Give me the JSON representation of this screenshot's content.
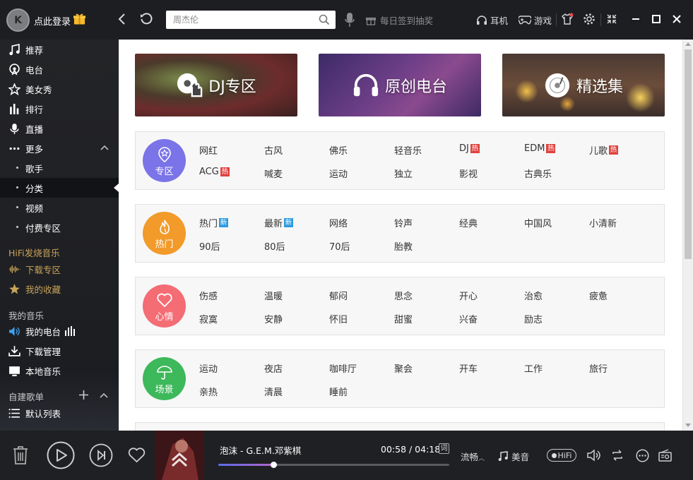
{
  "topbar": {
    "login_label": "点此登录",
    "search_placeholder": "周杰伦",
    "checkin_label": "每日签到抽奖",
    "headphone_label": "耳机",
    "game_label": "游戏"
  },
  "sidebar": {
    "items": [
      {
        "label": "推荐",
        "icon": "music-note-icon"
      },
      {
        "label": "电台",
        "icon": "radio-icon"
      },
      {
        "label": "美女秀",
        "icon": "star-icon"
      },
      {
        "label": "排行",
        "icon": "bar-chart-icon"
      },
      {
        "label": "直播",
        "icon": "mic-icon"
      },
      {
        "label": "更多",
        "icon": "more-dots-icon"
      }
    ],
    "sub_items": [
      "歌手",
      "分类",
      "视频",
      "付费专区"
    ],
    "hifi_section": "HiFi发烧音乐",
    "hifi_items": [
      "下载专区",
      "我的收藏"
    ],
    "my_music_section": "我的音乐",
    "my_music_items": [
      "我的电台",
      "下载管理",
      "本地音乐"
    ],
    "playlist_section": "自建歌单",
    "playlist_items": [
      "默认列表"
    ]
  },
  "banners": [
    {
      "title": "DJ专区"
    },
    {
      "title": "原创电台"
    },
    {
      "title": "精选集"
    }
  ],
  "categories": [
    {
      "badge": "专区",
      "color": "#7b73e8",
      "tags": [
        {
          "label": "网红"
        },
        {
          "label": "古风"
        },
        {
          "label": "佛乐"
        },
        {
          "label": "轻音乐"
        },
        {
          "label": "DJ",
          "mark": "热"
        },
        {
          "label": "EDM",
          "mark": "热"
        },
        {
          "label": "儿歌",
          "mark": "热"
        },
        {
          "label": "ACG",
          "mark": "热"
        },
        {
          "label": "喊麦"
        },
        {
          "label": "运动"
        },
        {
          "label": "独立"
        },
        {
          "label": "影视"
        },
        {
          "label": "古典乐"
        }
      ]
    },
    {
      "badge": "热门",
      "color": "#f29a2a",
      "tags": [
        {
          "label": "热门",
          "mark": "新"
        },
        {
          "label": "最新",
          "mark": "新"
        },
        {
          "label": "网络"
        },
        {
          "label": "铃声"
        },
        {
          "label": "经典"
        },
        {
          "label": "中国风"
        },
        {
          "label": "小清新"
        },
        {
          "label": "90后"
        },
        {
          "label": "80后"
        },
        {
          "label": "70后"
        },
        {
          "label": "胎教"
        }
      ]
    },
    {
      "badge": "心情",
      "color": "#f46c74",
      "tags": [
        {
          "label": "伤感"
        },
        {
          "label": "温暖"
        },
        {
          "label": "郁闷"
        },
        {
          "label": "思念"
        },
        {
          "label": "开心"
        },
        {
          "label": "治愈"
        },
        {
          "label": "疲惫"
        },
        {
          "label": "寂寞"
        },
        {
          "label": "安静"
        },
        {
          "label": "怀旧"
        },
        {
          "label": "甜蜜"
        },
        {
          "label": "兴奋"
        },
        {
          "label": "励志"
        }
      ]
    },
    {
      "badge": "场景",
      "color": "#3db85a",
      "tags": [
        {
          "label": "运动"
        },
        {
          "label": "夜店"
        },
        {
          "label": "咖啡厅"
        },
        {
          "label": "聚会"
        },
        {
          "label": "开车"
        },
        {
          "label": "工作"
        },
        {
          "label": "旅行"
        },
        {
          "label": "亲热"
        },
        {
          "label": "清晨"
        },
        {
          "label": "睡前"
        }
      ]
    }
  ],
  "player": {
    "song": "泡沫 - G.E.M.邓紫棋",
    "time": "00:58 / 04:18",
    "lyric_btn": "词",
    "progress": 0.24,
    "quality": "流畅",
    "sound_effect": "美音",
    "hifi_label": "HiFi"
  }
}
